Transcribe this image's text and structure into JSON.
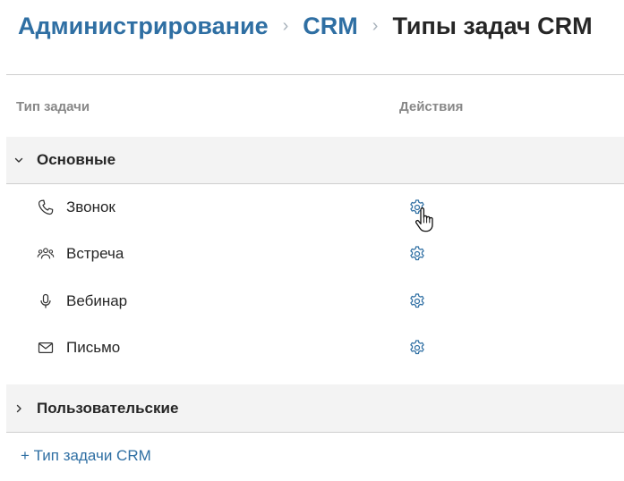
{
  "breadcrumb": {
    "items": [
      "Администрирование",
      "CRM"
    ],
    "current": "Типы задач CRM",
    "separator": "›"
  },
  "table": {
    "columns": {
      "type": "Тип задачи",
      "actions": "Действия"
    }
  },
  "groups": [
    {
      "label": "Основные",
      "expanded": true,
      "items": [
        {
          "label": "Звонок",
          "icon": "phone-icon",
          "action": "gear-icon"
        },
        {
          "label": "Встреча",
          "icon": "people-icon",
          "action": "gear-icon"
        },
        {
          "label": "Вебинар",
          "icon": "microphone-icon",
          "action": "gear-icon"
        },
        {
          "label": "Письмо",
          "icon": "envelope-icon",
          "action": "gear-icon"
        }
      ]
    },
    {
      "label": "Пользовательские",
      "expanded": false
    }
  ],
  "add_button": {
    "label": "+ Тип задачи CRM"
  },
  "colors": {
    "link": "#2f6fa3",
    "icon": "#2f6fa3",
    "group_bg": "#f3f3f3",
    "border": "#cfcfcf"
  }
}
